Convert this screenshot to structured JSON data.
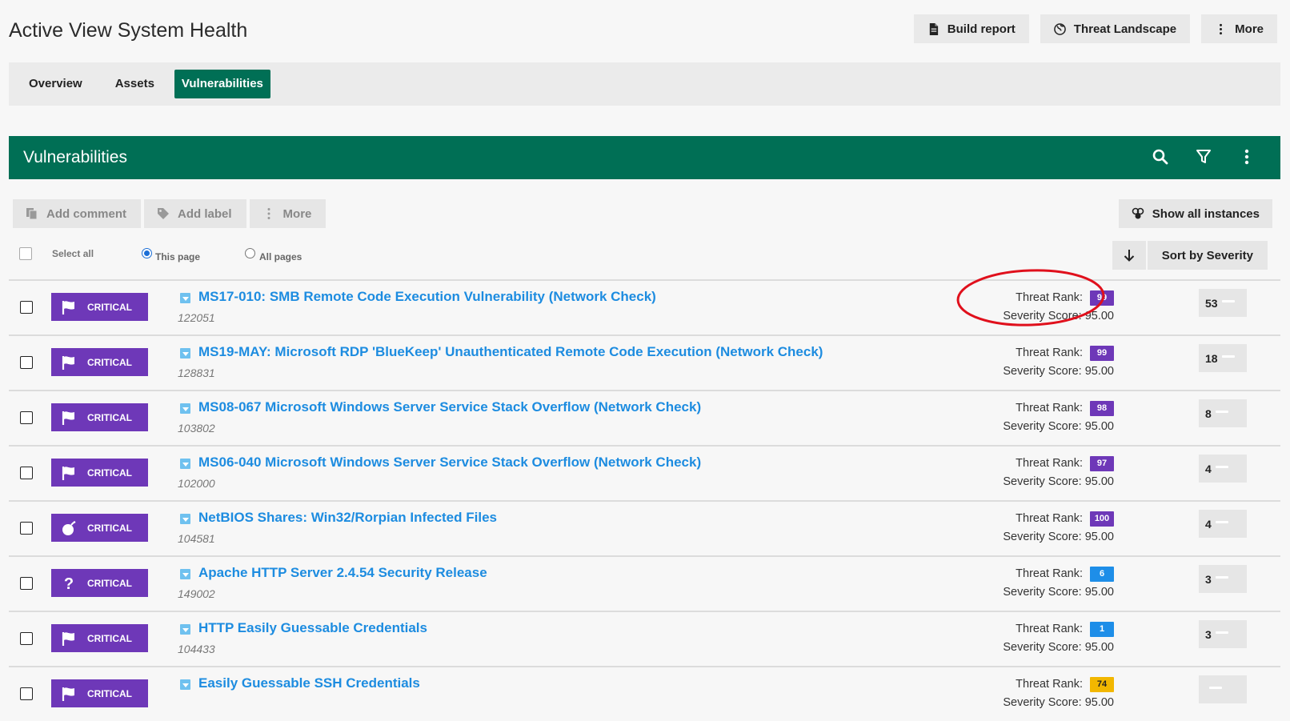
{
  "header": {
    "title": "Active View System Health",
    "actions": [
      {
        "label": "Build report",
        "icon": "document-icon"
      },
      {
        "label": "Threat Landscape",
        "icon": "globe-icon"
      },
      {
        "label": "More",
        "icon": "kebab-icon"
      }
    ]
  },
  "tabs": [
    {
      "label": "Overview",
      "active": false
    },
    {
      "label": "Assets",
      "active": false
    },
    {
      "label": "Vulnerabilities",
      "active": true
    }
  ],
  "panel": {
    "title": "Vulnerabilities",
    "icons": [
      "search-icon",
      "filter-icon",
      "kebab-icon"
    ]
  },
  "toolbar": {
    "add_comment": "Add comment",
    "add_label": "Add label",
    "more": "More",
    "show_all": "Show all instances"
  },
  "selection": {
    "select_all": "Select all",
    "this_page": "This page",
    "all_pages": "All pages",
    "selected_scope": "This page"
  },
  "sort": {
    "label": "Sort by Severity",
    "direction_icon": "arrow-down-icon"
  },
  "labels": {
    "threat_rank": "Threat Rank:",
    "severity_score": "Severity Score:"
  },
  "colors": {
    "accent": "#006f55",
    "critical": "#6e38b8",
    "link": "#1d8ce0",
    "rank_high": "#6e38b8",
    "rank_low": "#1e8ee8",
    "rank_mid": "#f2b700",
    "annotation": "#e0101c"
  },
  "vulnerabilities": [
    {
      "severity": "CRITICAL",
      "icon": "flag-icon",
      "title": "MS17-010: SMB Remote Code Execution Vulnerability (Network Check)",
      "id": "122051",
      "threat_rank": "99",
      "rank_color": "#6e38b8",
      "severity_score": "95.00",
      "count": "53"
    },
    {
      "severity": "CRITICAL",
      "icon": "flag-icon",
      "title": "MS19-MAY: Microsoft RDP 'BlueKeep' Unauthenticated Remote Code Execution (Network Check)",
      "id": "128831",
      "threat_rank": "99",
      "rank_color": "#6e38b8",
      "severity_score": "95.00",
      "count": "18"
    },
    {
      "severity": "CRITICAL",
      "icon": "flag-icon",
      "title": "MS08-067 Microsoft Windows Server Service Stack Overflow (Network Check)",
      "id": "103802",
      "threat_rank": "98",
      "rank_color": "#6e38b8",
      "severity_score": "95.00",
      "count": "8"
    },
    {
      "severity": "CRITICAL",
      "icon": "flag-icon",
      "title": "MS06-040 Microsoft Windows Server Service Stack Overflow (Network Check)",
      "id": "102000",
      "threat_rank": "97",
      "rank_color": "#6e38b8",
      "severity_score": "95.00",
      "count": "4"
    },
    {
      "severity": "CRITICAL",
      "icon": "bomb-icon",
      "title": "NetBIOS Shares: Win32/Rorpian Infected Files",
      "id": "104581",
      "threat_rank": "100",
      "rank_color": "#6e38b8",
      "severity_score": "95.00",
      "count": "4"
    },
    {
      "severity": "CRITICAL",
      "icon": "question-icon",
      "title": "Apache HTTP Server 2.4.54 Security Release",
      "id": "149002",
      "threat_rank": "6",
      "rank_color": "#1e8ee8",
      "severity_score": "95.00",
      "count": "3"
    },
    {
      "severity": "CRITICAL",
      "icon": "flag-icon",
      "title": "HTTP Easily Guessable Credentials",
      "id": "104433",
      "threat_rank": "1",
      "rank_color": "#1e8ee8",
      "severity_score": "95.00",
      "count": "3"
    },
    {
      "severity": "CRITICAL",
      "icon": "flag-icon",
      "title": "Easily Guessable SSH Credentials",
      "id": "",
      "threat_rank": "74",
      "rank_color": "#f2b700",
      "severity_score": "95.00",
      "count": ""
    }
  ]
}
